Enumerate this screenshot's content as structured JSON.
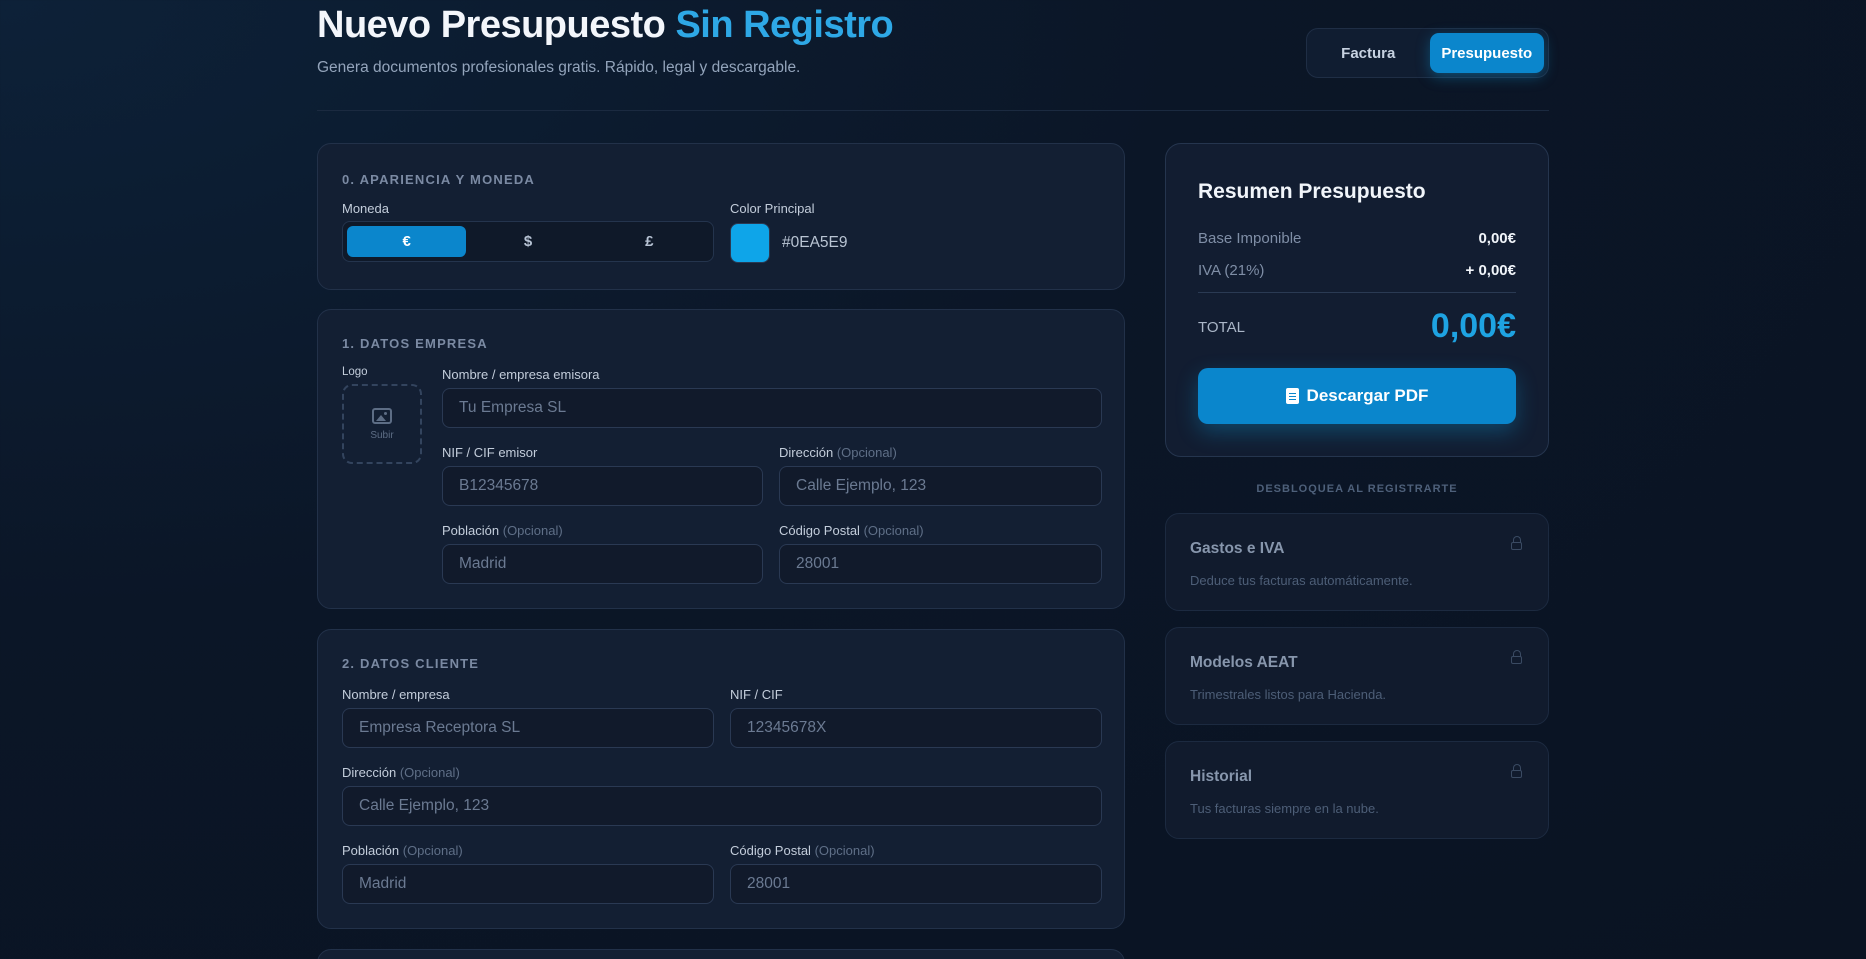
{
  "header": {
    "title_main": "Nuevo Presupuesto",
    "title_accent": "Sin Registro",
    "subtitle": "Genera documentos profesionales gratis. Rápido, legal y descargable.",
    "toggle": [
      {
        "label": "Factura",
        "active": false
      },
      {
        "label": "Presupuesto",
        "active": true
      }
    ]
  },
  "appearance": {
    "title": "0. APARIENCIA Y MONEDA",
    "currency_label": "Moneda",
    "currencies": [
      {
        "symbol": "€",
        "active": true
      },
      {
        "symbol": "$",
        "active": false
      },
      {
        "symbol": "£",
        "active": false
      }
    ],
    "color_label": "Color Principal",
    "color_value": "#0EA5E9"
  },
  "company": {
    "title": "1. DATOS EMPRESA",
    "logo_label": "Logo",
    "logo_upload": "Subir",
    "name_label": "Nombre / empresa emisora",
    "name_placeholder": "Tu Empresa SL",
    "nif_label": "NIF / CIF emisor",
    "nif_placeholder": "B12345678",
    "address_label": "Dirección",
    "address_placeholder": "Calle Ejemplo, 123",
    "city_label": "Población",
    "city_placeholder": "Madrid",
    "zip_label": "Código Postal",
    "zip_placeholder": "28001",
    "optional": "(Opcional)"
  },
  "client": {
    "title": "2. DATOS CLIENTE",
    "name_label": "Nombre / empresa",
    "name_placeholder": "Empresa Receptora SL",
    "nif_label": "NIF / CIF",
    "nif_placeholder": "12345678X",
    "address_label": "Dirección",
    "address_placeholder": "Calle Ejemplo, 123",
    "city_label": "Población",
    "city_placeholder": "Madrid",
    "zip_label": "Código Postal",
    "zip_placeholder": "28001",
    "optional": "(Opcional)"
  },
  "summary": {
    "title": "Resumen Presupuesto",
    "base_label": "Base Imponible",
    "base_value": "0,00€",
    "iva_label": "IVA (21%)",
    "iva_value": "+ 0,00€",
    "total_label": "TOTAL",
    "total_value": "0,00€",
    "download_label": "Descargar PDF"
  },
  "unlock": {
    "heading": "DESBLOQUEA AL REGISTRARTE",
    "features": [
      {
        "title": "Gastos e IVA",
        "desc": "Deduce tus facturas automáticamente."
      },
      {
        "title": "Modelos AEAT",
        "desc": "Trimestrales listos para Hacienda."
      },
      {
        "title": "Historial",
        "desc": "Tus facturas siempre en la nube."
      }
    ]
  },
  "colors": {
    "accent": "#0EA5E9",
    "button": "#0B86CC",
    "background": "#0B1627"
  }
}
